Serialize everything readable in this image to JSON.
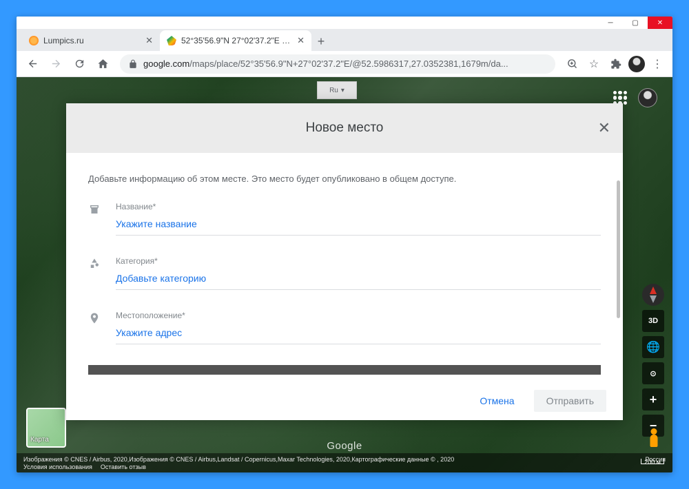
{
  "tabs": [
    {
      "title": "Lumpics.ru"
    },
    {
      "title": "52°35'56.9\"N 27°02'37.2\"E – Goo..."
    }
  ],
  "url": {
    "domain": "google.com",
    "path": "/maps/place/52°35'56.9\"N+27°02'37.2\"E/@52.5986317,27.0352381,1679m/da..."
  },
  "ru_chip": "Ru",
  "modal": {
    "title": "Новое место",
    "intro": "Добавьте информацию об этом месте. Это место будет опубликовано в общем доступе.",
    "fields": {
      "name": {
        "label": "Название*",
        "placeholder": "Укажите название"
      },
      "category": {
        "label": "Категория*",
        "placeholder": "Добавьте категорию"
      },
      "location": {
        "label": "Местоположение*",
        "placeholder": "Укажите адрес"
      }
    },
    "cancel": "Отмена",
    "submit": "Отправить"
  },
  "map_controls": {
    "three_d": "3D"
  },
  "mini_map": "Карта",
  "footer": {
    "attr": "Изображения © CNES / Airbus, 2020,Изображения © CNES / Airbus,Landsat / Copernicus,Maxar Technologies, 2020,Картографические данные © , 2020",
    "country": "Россия",
    "terms": "Условия использования",
    "feedback": "Оставить отзыв",
    "scale": "200 м"
  },
  "google_logo": "Google"
}
